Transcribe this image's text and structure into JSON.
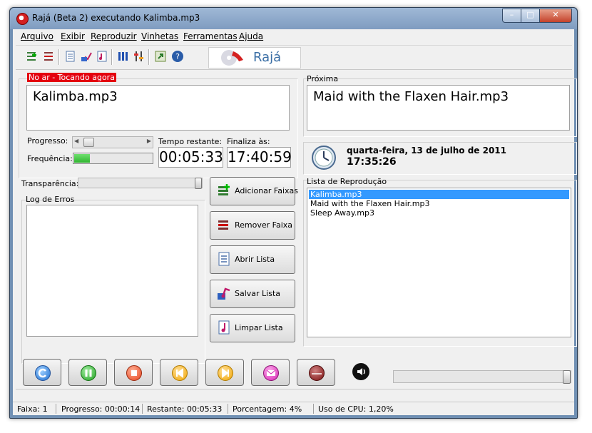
{
  "window": {
    "title": "Rajá (Beta 2) executando Kalimba.mp3",
    "min": "–",
    "max": "□",
    "close": "✕"
  },
  "menu": [
    "Arquivo",
    "Exibir",
    "Reproduzir",
    "Vinhetas",
    "Ferramentas",
    "Ajuda"
  ],
  "logo": {
    "text": "Rajá"
  },
  "now_playing": {
    "badge": "No ar - Tocando agora",
    "track": "Kalimba.mp3",
    "progress_label": "Progresso:",
    "progress_fraction": 0.04,
    "frequency_label": "Frequência:",
    "frequency_fraction": 0.2,
    "remaining_label": "Tempo restante:",
    "remaining_value": "00:05:33",
    "ends_label": "Finaliza às:",
    "ends_value": "17:40:59"
  },
  "next": {
    "label": "Próxima",
    "track": "Maid with the Flaxen Hair.mp3"
  },
  "clock": {
    "date": "quarta-feira, 13 de julho de 2011",
    "time": "17:35:26"
  },
  "transparency": {
    "label": "Transparência:",
    "fraction": 1.0
  },
  "error_log": {
    "label": "Log de Erros"
  },
  "actions": {
    "add": "Adicionar Faixas",
    "remove": "Remover Faixa",
    "open": "Abrir Lista",
    "save": "Salvar Lista",
    "clear": "Limpar Lista"
  },
  "playlist": {
    "label": "Lista de Reprodução",
    "items": [
      "Kalimba.mp3",
      "Maid with the Flaxen Hair.mp3",
      "Sleep Away.mp3"
    ],
    "selected_index": 0
  },
  "player_buttons": [
    "refresh",
    "pause",
    "stop",
    "previous",
    "next",
    "mail",
    "record"
  ],
  "colors": {
    "onair": "#e4000f",
    "selection": "#3399ff",
    "progress_green": "#2fb52f"
  },
  "volume": {
    "fraction": 1.0
  },
  "status": {
    "faixa": "Faixa: 1",
    "progresso": "Progresso: 00:00:14",
    "restante": "Restante: 00:05:33",
    "porcentagem": "Porcentagem: 4%",
    "cpu": "Uso de CPU: 1,20%"
  }
}
